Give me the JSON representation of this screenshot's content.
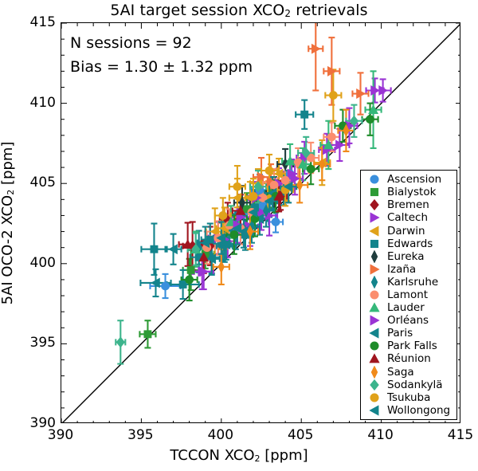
{
  "chart_data": {
    "type": "scatter",
    "title": "5AI target session XCO2 retrievals",
    "title_parts": {
      "pre": "5AI target session XCO",
      "sub": "2",
      "post": " retrievals"
    },
    "xlabel": "TCCON XCO2 [ppm]",
    "xlabel_parts": {
      "pre": "TCCON XCO",
      "sub": "2",
      "post": " [ppm]"
    },
    "ylabel": "5AI OCO-2 XCO2 [ppm]",
    "ylabel_parts": {
      "pre": "5AI OCO-2 XCO",
      "sub": "2",
      "post": " [ppm]"
    },
    "xlim": [
      390,
      415
    ],
    "ylim": [
      390,
      415
    ],
    "xticks": [
      390,
      395,
      400,
      405,
      410,
      415
    ],
    "yticks": [
      390,
      395,
      400,
      405,
      410,
      415
    ],
    "minor_tick_interval": 1,
    "grid": false,
    "one_to_one_line": true,
    "legend_position": "lower right",
    "annotations": [
      {
        "text": "N sessions = 92",
        "x": 390.6,
        "y": 413.6
      },
      {
        "text": "Bias = 1.30 ± 1.32 ppm",
        "x": 390.6,
        "y": 412.1
      }
    ],
    "n_sessions": 92,
    "bias": 1.3,
    "bias_sd": 1.32,
    "error_bars": "both",
    "series": [
      {
        "name": "Ascension",
        "color": "#3a8fdd",
        "marker": "circle",
        "points": [
          {
            "x": 396.5,
            "y": 398.6,
            "xerr": 0.95,
            "yerr": 0.75
          },
          {
            "x": 401.6,
            "y": 403.3,
            "xerr": 0.55,
            "yerr": 0.8
          },
          {
            "x": 402.4,
            "y": 404.6,
            "xerr": 0.5,
            "yerr": 0.95
          },
          {
            "x": 402.6,
            "y": 403.6,
            "xerr": 0.45,
            "yerr": 0.75
          },
          {
            "x": 403.0,
            "y": 404.0,
            "xerr": 0.5,
            "yerr": 0.7
          },
          {
            "x": 403.4,
            "y": 402.6,
            "xerr": 0.45,
            "yerr": 0.65
          },
          {
            "x": 404.3,
            "y": 405.6,
            "xerr": 0.5,
            "yerr": 0.8
          }
        ]
      },
      {
        "name": "Bialystok",
        "color": "#2e9b36",
        "marker": "square",
        "points": [
          {
            "x": 395.4,
            "y": 395.6,
            "xerr": 0.5,
            "yerr": 0.85
          },
          {
            "x": 398.1,
            "y": 399.6,
            "xerr": 0.5,
            "yerr": 1.25
          },
          {
            "x": 399.0,
            "y": 400.6,
            "xerr": 0.55,
            "yerr": 0.9
          },
          {
            "x": 401.6,
            "y": 403.4,
            "xerr": 0.5,
            "yerr": 1.0
          },
          {
            "x": 403.2,
            "y": 404.4,
            "xerr": 0.55,
            "yerr": 0.9
          }
        ]
      },
      {
        "name": "Bremen",
        "color": "#a0151f",
        "marker": "diamond",
        "points": [
          {
            "x": 398.2,
            "y": 401.1,
            "xerr": 0.6,
            "yerr": 1.5
          },
          {
            "x": 399.3,
            "y": 401.1,
            "xerr": 0.55,
            "yerr": 1.2
          },
          {
            "x": 400.4,
            "y": 402.7,
            "xerr": 0.5,
            "yerr": 1.1
          },
          {
            "x": 403.7,
            "y": 404.2,
            "xerr": 0.5,
            "yerr": 0.85
          }
        ]
      },
      {
        "name": "Caltech",
        "color": "#9a34d4",
        "marker": "triangle-right",
        "points": [
          {
            "x": 398.8,
            "y": 399.5,
            "xerr": 0.6,
            "yerr": 1.1
          },
          {
            "x": 399.8,
            "y": 401.6,
            "xerr": 0.6,
            "yerr": 1.0
          },
          {
            "x": 400.4,
            "y": 401.4,
            "xerr": 0.55,
            "yerr": 1.0
          },
          {
            "x": 401.2,
            "y": 402.9,
            "xerr": 0.55,
            "yerr": 1.0
          },
          {
            "x": 401.8,
            "y": 402.3,
            "xerr": 0.5,
            "yerr": 1.2
          },
          {
            "x": 402.5,
            "y": 403.2,
            "xerr": 0.5,
            "yerr": 1.1
          },
          {
            "x": 403.0,
            "y": 403.0,
            "xerr": 0.5,
            "yerr": 1.25
          },
          {
            "x": 403.6,
            "y": 405.0,
            "xerr": 0.5,
            "yerr": 0.95
          },
          {
            "x": 404.4,
            "y": 405.6,
            "xerr": 0.5,
            "yerr": 0.9
          },
          {
            "x": 405.2,
            "y": 406.6,
            "xerr": 0.5,
            "yerr": 1.0
          },
          {
            "x": 406.6,
            "y": 407.1,
            "xerr": 0.5,
            "yerr": 1.0
          },
          {
            "x": 408.0,
            "y": 408.6,
            "xerr": 0.5,
            "yerr": 1.1
          },
          {
            "x": 409.6,
            "y": 410.8,
            "xerr": 0.55,
            "yerr": 0.75
          },
          {
            "x": 410.1,
            "y": 410.8,
            "xerr": 0.5,
            "yerr": 0.7
          }
        ]
      },
      {
        "name": "Darwin",
        "color": "#e0a21a",
        "marker": "triangle-left",
        "points": [
          {
            "x": 399.6,
            "y": 402.0,
            "xerr": 0.55,
            "yerr": 1.45
          },
          {
            "x": 400.2,
            "y": 402.2,
            "xerr": 0.5,
            "yerr": 1.3
          },
          {
            "x": 401.0,
            "y": 404.1,
            "xerr": 0.5,
            "yerr": 1.2
          },
          {
            "x": 401.8,
            "y": 404.1,
            "xerr": 0.55,
            "yerr": 1.0
          },
          {
            "x": 402.3,
            "y": 405.0,
            "xerr": 0.5,
            "yerr": 0.9
          },
          {
            "x": 402.9,
            "y": 404.1,
            "xerr": 0.5,
            "yerr": 1.0
          },
          {
            "x": 403.6,
            "y": 405.6,
            "xerr": 0.5,
            "yerr": 0.95
          },
          {
            "x": 404.1,
            "y": 404.8,
            "xerr": 0.5,
            "yerr": 0.9
          },
          {
            "x": 406.3,
            "y": 406.3,
            "xerr": 0.5,
            "yerr": 1.4
          }
        ]
      },
      {
        "name": "Edwards",
        "color": "#13848c",
        "marker": "square",
        "points": [
          {
            "x": 395.8,
            "y": 400.9,
            "xerr": 0.8,
            "yerr": 1.6
          },
          {
            "x": 397.6,
            "y": 398.7,
            "xerr": 1.0,
            "yerr": 0.9
          },
          {
            "x": 398.6,
            "y": 400.4,
            "xerr": 0.55,
            "yerr": 0.95
          },
          {
            "x": 399.3,
            "y": 401.5,
            "xerr": 0.55,
            "yerr": 1.0
          },
          {
            "x": 400.1,
            "y": 401.2,
            "xerr": 0.5,
            "yerr": 1.0
          },
          {
            "x": 400.8,
            "y": 402.1,
            "xerr": 0.5,
            "yerr": 1.0
          },
          {
            "x": 401.5,
            "y": 401.8,
            "xerr": 0.5,
            "yerr": 0.95
          },
          {
            "x": 402.1,
            "y": 403.5,
            "xerr": 0.5,
            "yerr": 1.1
          },
          {
            "x": 405.2,
            "y": 409.3,
            "xerr": 0.55,
            "yerr": 0.9
          }
        ]
      },
      {
        "name": "Eureka",
        "color": "#1f3d3d",
        "marker": "thin-diamond",
        "points": [
          {
            "x": 401.3,
            "y": 403.8,
            "xerr": 0.5,
            "yerr": 1.05
          },
          {
            "x": 403.3,
            "y": 404.4,
            "xerr": 0.5,
            "yerr": 1.0
          },
          {
            "x": 404.0,
            "y": 406.2,
            "xerr": 0.5,
            "yerr": 0.95
          }
        ]
      },
      {
        "name": "Izaña",
        "color": "#f0703c",
        "marker": "triangle-right",
        "points": [
          {
            "x": 402.5,
            "y": 405.4,
            "xerr": 0.5,
            "yerr": 1.2
          },
          {
            "x": 403.1,
            "y": 405.1,
            "xerr": 0.5,
            "yerr": 1.1
          },
          {
            "x": 405.9,
            "y": 413.4,
            "xerr": 0.45,
            "yerr": 2.6
          },
          {
            "x": 406.9,
            "y": 412.0,
            "xerr": 0.5,
            "yerr": 2.1
          },
          {
            "x": 408.7,
            "y": 410.6,
            "xerr": 0.5,
            "yerr": 1.3
          }
        ]
      },
      {
        "name": "Karlsruhe",
        "color": "#13848c",
        "marker": "thin-diamond",
        "points": [
          {
            "x": 398.6,
            "y": 401.0,
            "xerr": 0.55,
            "yerr": 1.05
          },
          {
            "x": 399.4,
            "y": 400.4,
            "xerr": 0.5,
            "yerr": 1.0
          },
          {
            "x": 400.2,
            "y": 401.1,
            "xerr": 0.5,
            "yerr": 1.0
          },
          {
            "x": 400.9,
            "y": 401.8,
            "xerr": 0.5,
            "yerr": 0.9
          },
          {
            "x": 401.9,
            "y": 402.3,
            "xerr": 0.5,
            "yerr": 1.0
          },
          {
            "x": 402.8,
            "y": 403.3,
            "xerr": 0.5,
            "yerr": 1.0
          },
          {
            "x": 403.9,
            "y": 404.6,
            "xerr": 0.5,
            "yerr": 0.95
          }
        ]
      },
      {
        "name": "Lamont",
        "color": "#fb8e6e",
        "marker": "circle",
        "points": [
          {
            "x": 399.1,
            "y": 401.0,
            "xerr": 0.5,
            "yerr": 1.0
          },
          {
            "x": 399.8,
            "y": 401.6,
            "xerr": 0.5,
            "yerr": 1.05
          },
          {
            "x": 400.5,
            "y": 402.4,
            "xerr": 0.5,
            "yerr": 1.0
          },
          {
            "x": 401.2,
            "y": 402.2,
            "xerr": 0.5,
            "yerr": 1.0
          },
          {
            "x": 401.9,
            "y": 403.2,
            "xerr": 0.5,
            "yerr": 0.95
          },
          {
            "x": 402.6,
            "y": 404.1,
            "xerr": 0.5,
            "yerr": 1.0
          },
          {
            "x": 403.3,
            "y": 404.9,
            "xerr": 0.5,
            "yerr": 1.0
          },
          {
            "x": 404.0,
            "y": 405.2,
            "xerr": 0.5,
            "yerr": 0.95
          },
          {
            "x": 404.8,
            "y": 406.3,
            "xerr": 0.5,
            "yerr": 0.9
          },
          {
            "x": 405.6,
            "y": 406.6,
            "xerr": 0.5,
            "yerr": 0.95
          },
          {
            "x": 406.9,
            "y": 407.9,
            "xerr": 0.5,
            "yerr": 0.9
          }
        ]
      },
      {
        "name": "Lauder",
        "color": "#35b87a",
        "marker": "triangle-up",
        "points": [
          {
            "x": 398.4,
            "y": 400.9,
            "xerr": 0.5,
            "yerr": 1.1
          },
          {
            "x": 400.6,
            "y": 402.6,
            "xerr": 0.5,
            "yerr": 1.0
          },
          {
            "x": 404.3,
            "y": 406.4,
            "xerr": 0.5,
            "yerr": 1.05
          },
          {
            "x": 405.1,
            "y": 406.2,
            "xerr": 0.5,
            "yerr": 1.0
          },
          {
            "x": 406.7,
            "y": 407.4,
            "xerr": 0.5,
            "yerr": 1.5
          },
          {
            "x": 409.5,
            "y": 409.6,
            "xerr": 0.5,
            "yerr": 2.4
          }
        ]
      },
      {
        "name": "Orléans",
        "color": "#9a34d4",
        "marker": "triangle-right",
        "points": [
          {
            "x": 398.9,
            "y": 399.5,
            "xerr": 0.6,
            "yerr": 1.1
          },
          {
            "x": 401.0,
            "y": 402.4,
            "xerr": 0.5,
            "yerr": 1.1
          },
          {
            "x": 402.2,
            "y": 404.1,
            "xerr": 0.5,
            "yerr": 1.0
          },
          {
            "x": 404.6,
            "y": 405.3,
            "xerr": 0.5,
            "yerr": 1.0
          },
          {
            "x": 407.4,
            "y": 407.4,
            "xerr": 0.6,
            "yerr": 1.0
          }
        ]
      },
      {
        "name": "Paris",
        "color": "#13848c",
        "marker": "triangle-left",
        "points": [
          {
            "x": 395.9,
            "y": 398.8,
            "xerr": 0.95,
            "yerr": 0.85
          },
          {
            "x": 397.0,
            "y": 400.9,
            "xerr": 0.5,
            "yerr": 0.95
          },
          {
            "x": 399.4,
            "y": 400.3,
            "xerr": 0.5,
            "yerr": 1.0
          },
          {
            "x": 400.3,
            "y": 401.2,
            "xerr": 0.5,
            "yerr": 0.95
          },
          {
            "x": 401.4,
            "y": 402.0,
            "xerr": 0.5,
            "yerr": 1.0
          },
          {
            "x": 402.4,
            "y": 402.8,
            "xerr": 0.5,
            "yerr": 1.0
          },
          {
            "x": 403.2,
            "y": 404.4,
            "xerr": 0.5,
            "yerr": 1.0
          }
        ]
      },
      {
        "name": "Park Falls",
        "color": "#1e8c2a",
        "marker": "circle",
        "points": [
          {
            "x": 398.0,
            "y": 399.0,
            "xerr": 0.5,
            "yerr": 1.3
          },
          {
            "x": 400.8,
            "y": 401.8,
            "xerr": 0.5,
            "yerr": 1.2
          },
          {
            "x": 402.1,
            "y": 402.8,
            "xerr": 0.5,
            "yerr": 1.1
          },
          {
            "x": 403.4,
            "y": 404.2,
            "xerr": 0.5,
            "yerr": 1.0
          },
          {
            "x": 405.6,
            "y": 405.9,
            "xerr": 0.5,
            "yerr": 0.95
          },
          {
            "x": 407.6,
            "y": 408.6,
            "xerr": 0.5,
            "yerr": 1.0
          },
          {
            "x": 409.3,
            "y": 409.0,
            "xerr": 0.5,
            "yerr": 1.0
          }
        ]
      },
      {
        "name": "Réunion",
        "color": "#a0151f",
        "marker": "triangle-up",
        "points": [
          {
            "x": 397.9,
            "y": 401.2,
            "xerr": 0.55,
            "yerr": 1.35
          },
          {
            "x": 398.9,
            "y": 400.4,
            "xerr": 0.5,
            "yerr": 1.0
          },
          {
            "x": 401.2,
            "y": 403.3,
            "xerr": 0.5,
            "yerr": 1.0
          },
          {
            "x": 403.6,
            "y": 404.2,
            "xerr": 0.5,
            "yerr": 0.95
          }
        ]
      },
      {
        "name": "Saga",
        "color": "#f08a1a",
        "marker": "thin-diamond",
        "points": [
          {
            "x": 400.0,
            "y": 399.8,
            "xerr": 0.5,
            "yerr": 1.1
          },
          {
            "x": 401.8,
            "y": 402.0,
            "xerr": 0.5,
            "yerr": 1.1
          },
          {
            "x": 404.9,
            "y": 404.9,
            "xerr": 0.5,
            "yerr": 1.1
          },
          {
            "x": 406.3,
            "y": 406.2,
            "xerr": 0.5,
            "yerr": 1.0
          },
          {
            "x": 407.8,
            "y": 408.3,
            "xerr": 0.5,
            "yerr": 1.3
          }
        ]
      },
      {
        "name": "Sodankylä",
        "color": "#3cb48c",
        "marker": "diamond",
        "points": [
          {
            "x": 393.7,
            "y": 395.1,
            "xerr": 0.3,
            "yerr": 1.35
          },
          {
            "x": 398.4,
            "y": 400.9,
            "xerr": 0.5,
            "yerr": 1.0
          },
          {
            "x": 402.3,
            "y": 404.8,
            "xerr": 0.5,
            "yerr": 1.0
          },
          {
            "x": 405.3,
            "y": 406.9,
            "xerr": 0.5,
            "yerr": 1.0
          },
          {
            "x": 408.3,
            "y": 408.9,
            "xerr": 0.5,
            "yerr": 1.0
          }
        ]
      },
      {
        "name": "Tsukuba",
        "color": "#e0a21a",
        "marker": "circle",
        "points": [
          {
            "x": 400.1,
            "y": 403.0,
            "xerr": 0.5,
            "yerr": 1.1
          },
          {
            "x": 401.0,
            "y": 404.8,
            "xerr": 0.5,
            "yerr": 1.3
          },
          {
            "x": 402.0,
            "y": 404.2,
            "xerr": 0.5,
            "yerr": 1.1
          },
          {
            "x": 403.0,
            "y": 405.8,
            "xerr": 0.5,
            "yerr": 1.0
          },
          {
            "x": 404.0,
            "y": 404.6,
            "xerr": 0.5,
            "yerr": 1.0
          },
          {
            "x": 407.0,
            "y": 410.5,
            "xerr": 0.5,
            "yerr": 1.6
          }
        ]
      },
      {
        "name": "Wollongong",
        "color": "#13848c",
        "marker": "triangle-left",
        "points": [
          {
            "x": 399.0,
            "y": 401.3,
            "xerr": 0.5,
            "yerr": 1.0
          },
          {
            "x": 400.0,
            "y": 401.6,
            "xerr": 0.5,
            "yerr": 1.0
          },
          {
            "x": 401.0,
            "y": 402.2,
            "xerr": 0.5,
            "yerr": 1.0
          },
          {
            "x": 402.0,
            "y": 403.2,
            "xerr": 0.5,
            "yerr": 1.0
          },
          {
            "x": 403.0,
            "y": 403.9,
            "xerr": 0.5,
            "yerr": 1.0
          },
          {
            "x": 404.2,
            "y": 404.8,
            "xerr": 0.5,
            "yerr": 1.0
          }
        ]
      }
    ]
  }
}
